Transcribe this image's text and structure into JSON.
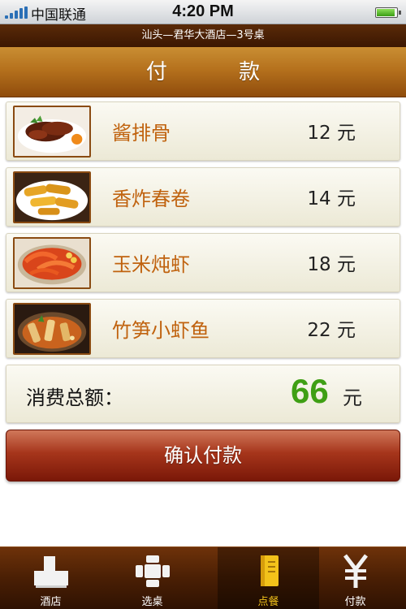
{
  "status_bar": {
    "carrier": "中国联通",
    "time": "4:20 PM"
  },
  "header": {
    "subtitle": "汕头—君华大酒店—3号桌",
    "title": "付  款"
  },
  "items": [
    {
      "name": "酱排骨",
      "price": "12 元",
      "image": "braised-ribs-photo"
    },
    {
      "name": "香炸春卷",
      "price": "14 元",
      "image": "spring-rolls-photo"
    },
    {
      "name": "玉米炖虾",
      "price": "18 元",
      "image": "corn-shrimp-photo"
    },
    {
      "name": "竹笋小虾鱼",
      "price": "22 元",
      "image": "bamboo-shoot-fish-photo"
    }
  ],
  "total": {
    "label": "消费总额：",
    "amount": "66",
    "unit": "元"
  },
  "confirm": {
    "label": "确认付款"
  },
  "tabs": [
    {
      "label": "酒店",
      "icon": "hotel-icon",
      "active": false
    },
    {
      "label": "选桌",
      "icon": "table-icon",
      "active": false
    },
    {
      "label": "点餐",
      "icon": "menu-book-icon",
      "active": true
    },
    {
      "label": "付款",
      "icon": "yen-icon",
      "active": false
    }
  ],
  "colors": {
    "accent_orange": "#c0620e",
    "total_green": "#3f9f14",
    "active_tab": "#f3c21a",
    "header_brown": "#b5711d"
  }
}
